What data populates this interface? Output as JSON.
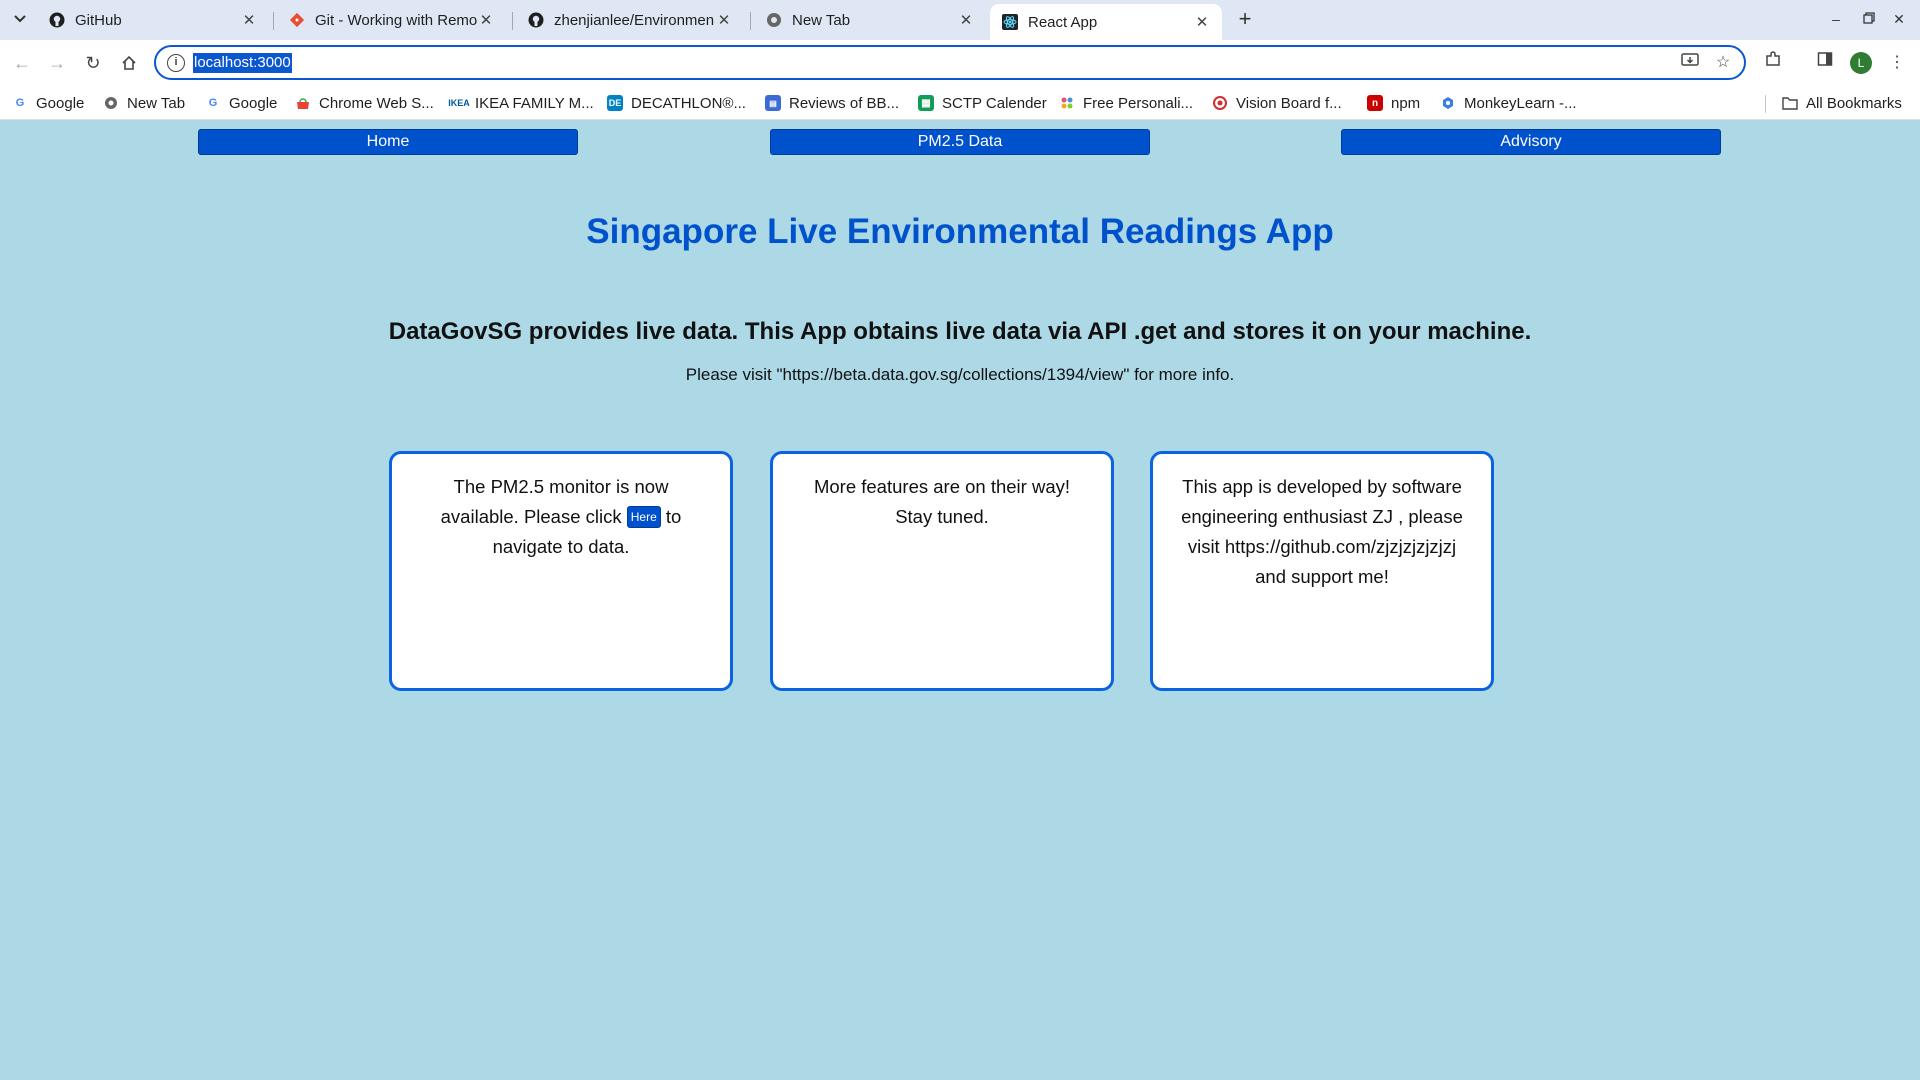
{
  "browser": {
    "tabs": [
      {
        "title": "GitHub",
        "icon": "github-icon"
      },
      {
        "title": "Git - Working with Remo",
        "icon": "git-icon"
      },
      {
        "title": "zhenjianlee/Environmen",
        "icon": "github-icon"
      },
      {
        "title": "New Tab",
        "icon": "chrome-icon"
      },
      {
        "title": "React App",
        "icon": "react-icon",
        "active": true
      }
    ],
    "url": "localhost:3000",
    "profile_initial": "L",
    "bookmarks": [
      {
        "label": "Google",
        "icon": "google-icon"
      },
      {
        "label": "New Tab",
        "icon": "chrome-icon"
      },
      {
        "label": "Google",
        "icon": "google-icon"
      },
      {
        "label": "Chrome Web S...",
        "icon": "webstore-icon"
      },
      {
        "label": "IKEA FAMILY M...",
        "icon": "ikea-icon"
      },
      {
        "label": "DECATHLON®...",
        "icon": "decathlon-icon"
      },
      {
        "label": "Reviews of BB...",
        "icon": "reviews-icon"
      },
      {
        "label": "SCTP Calender",
        "icon": "sheets-icon"
      },
      {
        "label": "Free Personali...",
        "icon": "personality-icon"
      },
      {
        "label": "Vision Board f...",
        "icon": "vision-icon"
      },
      {
        "label": "npm",
        "icon": "npm-icon"
      },
      {
        "label": "MonkeyLearn -...",
        "icon": "monkeylearn-icon"
      }
    ],
    "all_bookmarks": "All Bookmarks"
  },
  "nav": {
    "home": "Home",
    "pm25": "PM2.5 Data",
    "advisory": "Advisory"
  },
  "main": {
    "title": "Singapore Live Environmental Readings App",
    "subtitle": "DataGovSG provides live data. This App obtains live data via API .get and stores it on your machine.",
    "info": "Please visit \"https://beta.data.gov.sg/collections/1394/view\" for more info."
  },
  "cards": [
    {
      "text_before": "The PM2.5 monitor is now available. Please click",
      "link": "Here",
      "text_after": "to navigate to data."
    },
    {
      "text": "More features are on their way! Stay tuned."
    },
    {
      "text": "This app is developed by software engineering enthusiast ZJ , please visit https://github.com/zjzjzjzjzjzj and support me!"
    }
  ],
  "colors": {
    "page_bg": "#add8e6",
    "accent": "#0052cc",
    "card_border": "#0b63e0"
  }
}
